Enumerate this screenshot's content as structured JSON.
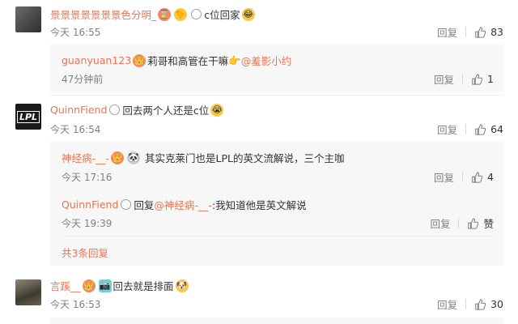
{
  "comments": [
    {
      "username": "景景景景景景景色分明_",
      "text": "c位回家",
      "time": "今天 16:55",
      "reply_label": "回复",
      "likes": "83"
    },
    {
      "username": "QuinnFiend",
      "text": "回去两个人还是c位",
      "time": "今天 16:54",
      "reply_label": "回复",
      "likes": "64",
      "avatar_text": "LPL"
    },
    {
      "username": "言蹊__",
      "text": "回去就是排面",
      "time": "今天 16:53",
      "reply_label": "回复",
      "likes": "30"
    }
  ],
  "replies": [
    {
      "username": "guanyuan123",
      "text": "莉哥和高管在干嘛",
      "mention": "@羞影小约",
      "time": "47分钟前",
      "reply_label": "回复",
      "likes": "1"
    },
    {
      "username": "神经病-__-",
      "text": "其实克莱门也是LPL的英文流解说，三个主咖",
      "time": "今天 17:16",
      "reply_label": "回复",
      "likes": "4"
    },
    {
      "username": "QuinnFiend",
      "prefix": "回复",
      "mention": "@神经病-__-",
      "text": ":我知道他是英文解说",
      "time": "今天 19:39",
      "reply_label": "回复",
      "likes": "赞"
    }
  ],
  "more_replies": "共3条回复",
  "colors": {
    "accent": "#eb7350",
    "subbox": "#f7f7f7"
  },
  "icons": [
    "thumbs-up-icon",
    "hourglass-icon",
    "duck-emoji-icon",
    "medal-badge-icon",
    "laugh-emoji-icon",
    "panda-emoji-icon",
    "camera-badge-icon"
  ]
}
